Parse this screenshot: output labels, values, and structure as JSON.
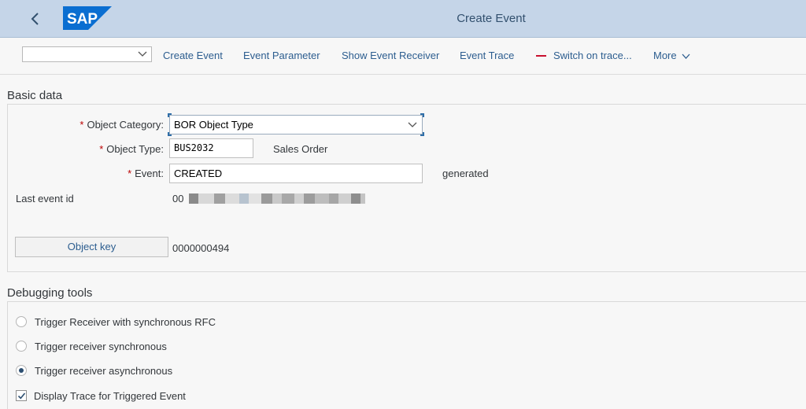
{
  "shell": {
    "back_icon": "chevron-left-icon",
    "logo_text": "SAP",
    "title": "Create Event",
    "brand_color": "#0a6ed1"
  },
  "toolbar": {
    "select_value": "",
    "items": [
      "Create Event",
      "Event Parameter",
      "Show Event Receiver",
      "Event Trace",
      "Switch on trace...",
      "More"
    ]
  },
  "basic": {
    "title": "Basic data",
    "object_category_label": "Object Category:",
    "object_category_value": "BOR Object Type",
    "object_type_label": "Object Type:",
    "object_type_value": "BUS2032",
    "object_type_desc": "Sales Order",
    "event_label": "Event:",
    "event_value": "CREATED",
    "event_desc": "generated",
    "last_event_label": "Last event id",
    "last_event_value": "00",
    "object_key_button": "Object key",
    "object_key_value": "0000000494",
    "required_marker": "*"
  },
  "debug": {
    "title": "Debugging tools",
    "options": [
      {
        "label": "Trigger Receiver with synchronous RFC",
        "selected": false
      },
      {
        "label": "Trigger receiver synchronous",
        "selected": false
      },
      {
        "label": "Trigger receiver asynchronous",
        "selected": true
      }
    ],
    "checkbox_label": "Display Trace for Triggered Event",
    "checkbox_checked": true
  }
}
